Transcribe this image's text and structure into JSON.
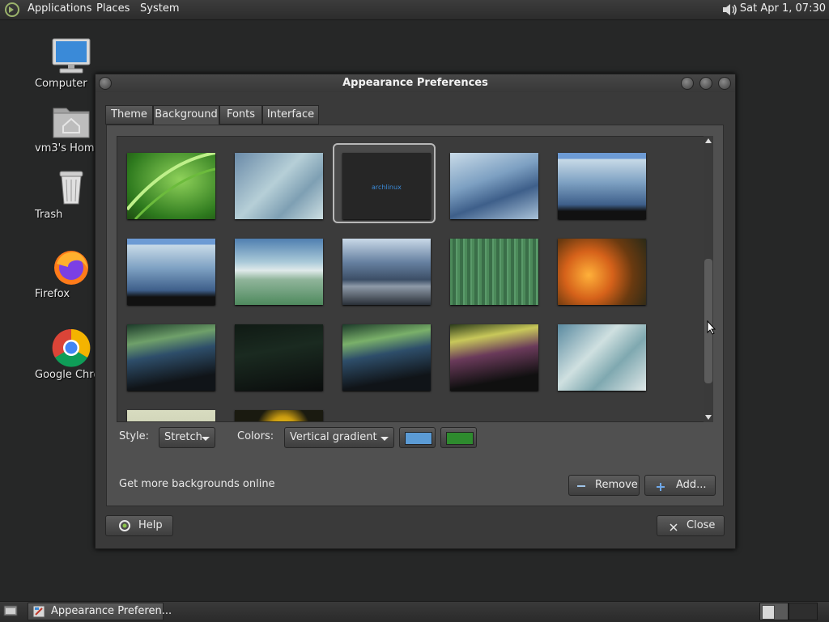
{
  "top_panel": {
    "menus": [
      "Applications",
      "Places",
      "System"
    ],
    "clock": "Sat Apr  1, 07:30"
  },
  "desktop_icons": [
    {
      "label": "Computer",
      "icon": "computer-icon"
    },
    {
      "label": "vm3's Hom",
      "icon": "home-folder-icon"
    },
    {
      "label": "Trash",
      "icon": "trash-icon"
    },
    {
      "label": "Firefox",
      "icon": "firefox-icon"
    },
    {
      "label": "Google Chro",
      "icon": "chrome-icon"
    }
  ],
  "window": {
    "title": "Appearance Preferences",
    "tabs": [
      "Theme",
      "Background",
      "Fonts",
      "Interface"
    ],
    "active_tab": "Background",
    "wallpapers_selected": "archlinux",
    "wallpaper_text": "archlinux",
    "style_label": "Style:",
    "style_value": "Stretch",
    "colors_label": "Colors:",
    "colors_value": "Vertical gradient",
    "color1": "#5b9bd5",
    "color2": "#2e8b2e",
    "get_more_label": "Get more backgrounds online",
    "remove_label": "Remove",
    "add_label": "Add...",
    "help_label": "Help",
    "close_label": "Close"
  },
  "taskbar": {
    "task_label": "Appearance Preferen..."
  }
}
